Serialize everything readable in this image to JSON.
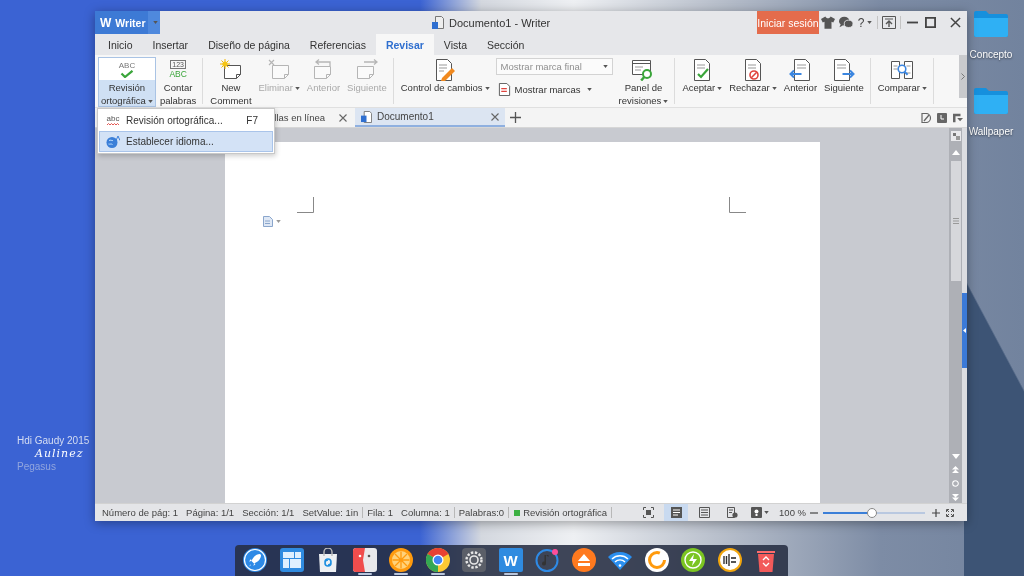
{
  "window": {
    "app_button": {
      "logo": "W",
      "label": "Writer"
    },
    "title": "Documento1 - Writer",
    "login_button": "Iniciar sesión",
    "help_button": "?"
  },
  "menu_tabs": [
    {
      "label": "Inicio",
      "selected": false
    },
    {
      "label": "Insertar",
      "selected": false
    },
    {
      "label": "Diseño de página",
      "selected": false
    },
    {
      "label": "Referencias",
      "selected": false
    },
    {
      "label": "Revisar",
      "selected": true
    },
    {
      "label": "Vista",
      "selected": false
    },
    {
      "label": "Sección",
      "selected": false
    }
  ],
  "ribbon": {
    "groups": [
      {
        "items": [
          {
            "kind": "large",
            "label": "Revisión\nortográfica",
            "icon_text": [
              "ABC"
            ],
            "dropdown": true,
            "disabled": false,
            "expanded": true
          },
          {
            "kind": "large",
            "label": "Contar\npalabras",
            "icon_text": [
              "123",
              "ABC"
            ],
            "dropdown": false,
            "disabled": false,
            "expanded": false
          }
        ]
      },
      {
        "items": [
          {
            "kind": "large",
            "label": "New\nComment",
            "dropdown": false,
            "disabled": false,
            "expanded": false
          },
          {
            "kind": "large",
            "label": "Eliminar",
            "dropdown": true,
            "disabled": true,
            "expanded": false
          },
          {
            "kind": "large",
            "label": "Anterior",
            "dropdown": false,
            "disabled": true,
            "expanded": false
          },
          {
            "kind": "large",
            "label": "Siguiente",
            "dropdown": false,
            "disabled": true,
            "expanded": false
          }
        ]
      },
      {
        "items": [
          {
            "kind": "large",
            "label": "Control de cambios",
            "dropdown": true,
            "disabled": false,
            "expanded": false
          },
          {
            "kind": "stack",
            "combo": {
              "value": "Mostrar marca final",
              "disabled": true
            },
            "button": {
              "label": "Mostrar marcas",
              "dropdown": true
            }
          },
          {
            "kind": "large",
            "label": "Panel de\nrevisiones",
            "dropdown": true,
            "disabled": false,
            "expanded": false
          }
        ]
      },
      {
        "items": [
          {
            "kind": "large",
            "label": "Aceptar",
            "dropdown": true,
            "disabled": false,
            "expanded": false
          },
          {
            "kind": "large",
            "label": "Rechazar",
            "dropdown": true,
            "disabled": false,
            "expanded": false
          },
          {
            "kind": "large",
            "label": "Anterior",
            "dropdown": false,
            "disabled": false,
            "expanded": false
          },
          {
            "kind": "large",
            "label": "Siguiente",
            "dropdown": false,
            "disabled": false,
            "expanded": false
          }
        ]
      },
      {
        "items": [
          {
            "kind": "large",
            "label": "Comparar",
            "dropdown": true,
            "disabled": false,
            "expanded": false
          }
        ]
      }
    ]
  },
  "spell_menu": {
    "items": [
      {
        "label": "Revisión ortográfica...",
        "icon_text": "abc",
        "shortcut": "F7",
        "highlighted": false
      },
      {
        "label": "Establecer idioma...",
        "highlighted": true
      }
    ]
  },
  "document_tabs": [
    {
      "label": "llas en línea",
      "selected": false
    },
    {
      "label": "Documento1",
      "selected": true
    }
  ],
  "status_bar": {
    "fields": [
      "Número de pág: 1",
      "Página: 1/1",
      "Sección: 1/1",
      "SetValue: 1in",
      "Fila: 1",
      "Columna: 1",
      "Palabras:0"
    ],
    "spell_check": "Revisión ortográfica",
    "views": [
      {
        "selected": true
      },
      {
        "selected": false
      },
      {
        "selected": false
      }
    ],
    "zoom": {
      "label": "100 %",
      "level": 0.48
    }
  },
  "dock": {
    "items": [
      {
        "running": false
      },
      {
        "running": false
      },
      {
        "running": false
      },
      {
        "running": true
      },
      {
        "running": true
      },
      {
        "running": true
      },
      {
        "running": false
      },
      {
        "logo": "W",
        "running": true
      },
      {
        "running": false
      },
      {
        "running": false
      },
      {
        "running": false
      },
      {
        "running": false
      },
      {
        "running": false
      },
      {
        "running": false
      },
      {
        "running": false
      }
    ]
  },
  "desktop": {
    "icons": [
      {
        "label": "Concepto"
      },
      {
        "label": "Wallpaper"
      }
    ],
    "wallpaper_text": [
      "Hdi Gaudy 2015",
      "Aulinez",
      "Pegasus"
    ]
  }
}
